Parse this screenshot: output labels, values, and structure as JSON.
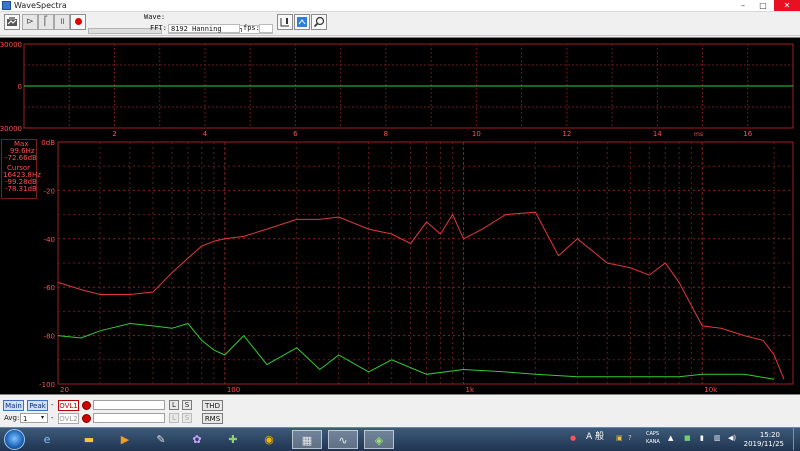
{
  "window": {
    "title": "WaveSpectra",
    "minimize": "–",
    "maximize": "□",
    "close": "✕"
  },
  "toolbar": {
    "wave_label": "Wave:",
    "wave_value": "48000Hz 16bit 1ch",
    "fft_label": "FFT:",
    "fft_value": "8192 Hanning",
    "fps_label": "fps:",
    "fps_value": "",
    "buttons": [
      "open",
      "prev",
      "pause",
      "record",
      "settings",
      "zoom"
    ]
  },
  "waveform": {
    "y_ticks": [
      "30000",
      "0",
      "-30000"
    ],
    "x_ticks": [
      "2",
      "4",
      "6",
      "8",
      "10",
      "12",
      "14",
      "16"
    ],
    "x_unit": "ms"
  },
  "spectrum": {
    "y_ticks": [
      "0dB",
      "-20",
      "-40",
      "-60",
      "-80",
      "-100"
    ],
    "x_ticks": [
      "20",
      "100",
      "1k",
      "10k"
    ],
    "max_label": "Max",
    "max_freq": "99.6Hz",
    "max_db": "-72.66dB",
    "cursor_label": "Cursor",
    "cursor_freq": "16423.8Hz",
    "cursor_db1": "-99.28dB",
    "cursor_db2": "-78.31dB",
    "colors": {
      "left": "#e03a3a",
      "green": "#33cc33",
      "grid": "#6a1a1a",
      "axis_text": "#ff5050"
    }
  },
  "chart_data": [
    {
      "type": "line",
      "title": "",
      "xlabel": "ms",
      "ylabel": "",
      "xlim": [
        0,
        17
      ],
      "ylim": [
        -30000,
        30000
      ],
      "series": [
        {
          "x": [
            0,
            17
          ],
          "values": [
            0,
            0
          ]
        }
      ]
    },
    {
      "type": "line",
      "title": "",
      "xlabel": "",
      "ylabel": "",
      "x_scale": "log",
      "xlim": [
        20,
        24000
      ],
      "ylim": [
        -100,
        0
      ],
      "series": [
        {
          "x": [
            20,
            25,
            30,
            40,
            50,
            60,
            70,
            80,
            90,
            100,
            120,
            150,
            200,
            250,
            300,
            400,
            500,
            600,
            700,
            800,
            900,
            1000,
            1200,
            1500,
            2000,
            2500,
            3000,
            4000,
            5000,
            6000,
            7000,
            8000,
            10000,
            12000,
            15000,
            18000,
            20000,
            22000
          ],
          "values": [
            -58,
            -61,
            -63,
            -63,
            -62,
            -54,
            -48,
            -43,
            -41,
            -40,
            -39,
            -36,
            -32,
            -32,
            -31,
            -36,
            -38,
            -42,
            -33,
            -38,
            -30,
            -40,
            -36,
            -30,
            -29,
            -47,
            -40,
            -50,
            -52,
            -55,
            -50,
            -58,
            -76,
            -77,
            -80,
            -82,
            -88,
            -98
          ]
        },
        {
          "x": [
            20,
            25,
            30,
            40,
            50,
            60,
            70,
            80,
            90,
            100,
            120,
            150,
            200,
            250,
            300,
            400,
            500,
            700,
            1000,
            1500,
            2000,
            3000,
            5000,
            8000,
            10000,
            15000,
            20000
          ],
          "values": [
            -80,
            -81,
            -78,
            -75,
            -76,
            -77,
            -75,
            -82,
            -86,
            -88,
            -80,
            -92,
            -85,
            -94,
            -88,
            -95,
            -90,
            -96,
            -94,
            -95,
            -96,
            -97,
            -97,
            -97,
            -96,
            -96,
            -98
          ]
        }
      ]
    }
  ],
  "bottom": {
    "main": "Main",
    "peak": "Peak",
    "ovl1": "OVL1",
    "ovl2": "OVL2",
    "dash": "-",
    "avg_label": "Avg:",
    "avg_value": "1",
    "l": "L",
    "s": "S",
    "thd": "THD",
    "rms": "RMS"
  },
  "taskbar": {
    "apps": [
      "explorer",
      "media-player",
      "paint",
      "network",
      "chrome",
      "wavespectra",
      "wavegene",
      "other-app"
    ],
    "ime": "A 般",
    "caps": "CAPS",
    "kana": "KANA",
    "time": "15:20",
    "date": "2019/11/25"
  }
}
